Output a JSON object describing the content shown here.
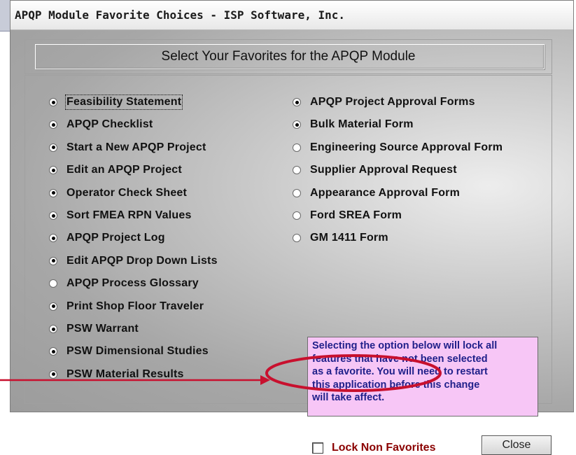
{
  "window": {
    "title": "APQP Module Favorite Choices - ISP Software, Inc.",
    "header": "Select Your Favorites for the APQP Module"
  },
  "left_options": [
    {
      "label": "Feasibility Statement",
      "selected": true
    },
    {
      "label": "APQP Checklist",
      "selected": true
    },
    {
      "label": "Start a New APQP Project",
      "selected": true
    },
    {
      "label": "Edit an APQP Project",
      "selected": true
    },
    {
      "label": "Operator Check Sheet",
      "selected": true
    },
    {
      "label": "Sort FMEA RPN Values",
      "selected": true
    },
    {
      "label": "APQP Project Log",
      "selected": true
    },
    {
      "label": "Edit APQP Drop Down Lists",
      "selected": true
    },
    {
      "label": "APQP Process Glossary",
      "selected": false
    },
    {
      "label": "Print Shop Floor Traveler",
      "selected": true
    },
    {
      "label": "PSW Warrant",
      "selected": true
    },
    {
      "label": "PSW Dimensional Studies",
      "selected": true
    },
    {
      "label": "PSW Material Results",
      "selected": true
    }
  ],
  "right_options": [
    {
      "label": "APQP Project Approval Forms",
      "selected": true
    },
    {
      "label": "Bulk Material Form",
      "selected": true
    },
    {
      "label": "Engineering Source Approval Form",
      "selected": false
    },
    {
      "label": "Supplier Approval Request",
      "selected": false
    },
    {
      "label": "Appearance Approval Form",
      "selected": false
    },
    {
      "label": "Ford SREA Form",
      "selected": false
    },
    {
      "label": "GM 1411 Form",
      "selected": false
    }
  ],
  "note": {
    "lines": [
      "Selecting the option below will lock all",
      "features that have not been selected",
      "as a favorite. You will need to restart",
      "this application before this change",
      "will take affect."
    ]
  },
  "lock": {
    "label": "Lock Non Favorites",
    "checked": false
  },
  "buttons": {
    "close": "Close"
  },
  "annotation": {
    "color": "#c8102e"
  }
}
